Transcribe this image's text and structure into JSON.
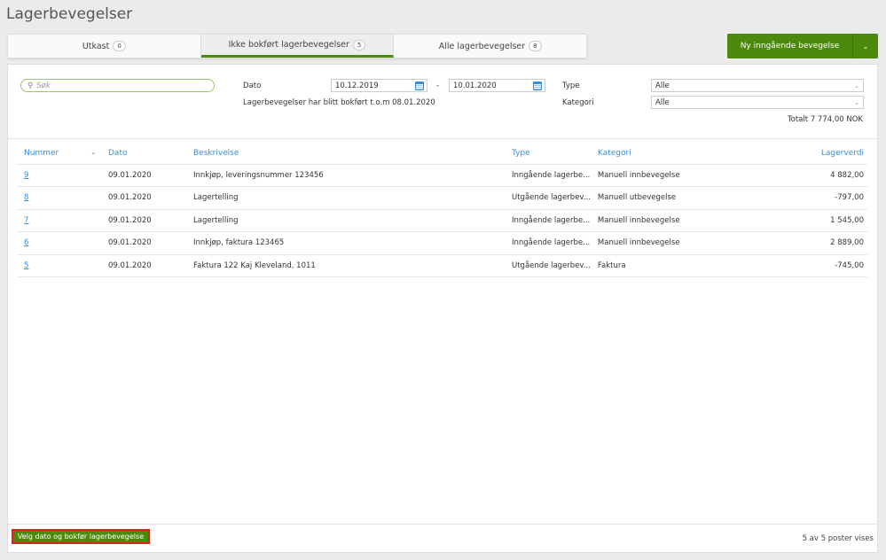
{
  "page": {
    "title": "Lagerbevegelser"
  },
  "tabs": [
    {
      "label": "Utkast",
      "count": "0"
    },
    {
      "label": "Ikke bokført lagerbevegelser",
      "count": "5"
    },
    {
      "label": "Alle lagerbevegelser",
      "count": "8"
    }
  ],
  "new_button": {
    "label": "Ny inngående bevegelse"
  },
  "filters": {
    "search_placeholder": "Søk",
    "date_label": "Dato",
    "date_from": "10.12.2019",
    "date_to": "10.01.2020",
    "date_sep": "-",
    "info": "Lagerbevegelser har blitt bokført t.o.m 08.01.2020",
    "type_label": "Type",
    "type_value": "Alle",
    "category_label": "Kategori",
    "category_value": "Alle",
    "total": "Totalt 7 774,00 NOK"
  },
  "table": {
    "headers": [
      "Nummer",
      "Dato",
      "Beskrivelse",
      "Type",
      "Kategori",
      "Lagerverdi"
    ],
    "rows": [
      [
        "9",
        "09.01.2020",
        "Innkjøp, leveringsnummer 123456",
        "Inngående lagerbe...",
        "Manuell innbevegelse",
        "4 882,00"
      ],
      [
        "8",
        "09.01.2020",
        "Lagertelling",
        "Utgående lagerbev...",
        "Manuell utbevegelse",
        "-797,00"
      ],
      [
        "7",
        "09.01.2020",
        "Lagertelling",
        "Inngående lagerbe...",
        "Manuell innbevegelse",
        "1 545,00"
      ],
      [
        "6",
        "09.01.2020",
        "Innkjøp, faktura 123465",
        "Inngående lagerbe...",
        "Manuell innbevegelse",
        "2 889,00"
      ],
      [
        "5",
        "09.01.2020",
        "Faktura 122 Kaj Kleveland, 1011",
        "Utgående lagerbev...",
        "Faktura",
        "-745,00"
      ]
    ]
  },
  "footer": {
    "action_label": "Velg dato og bokfør lagerbevegelse",
    "count": "5 av 5 poster vises"
  },
  "colors": {
    "accent": "#4c8a0b",
    "link": "#3a8fd8"
  }
}
